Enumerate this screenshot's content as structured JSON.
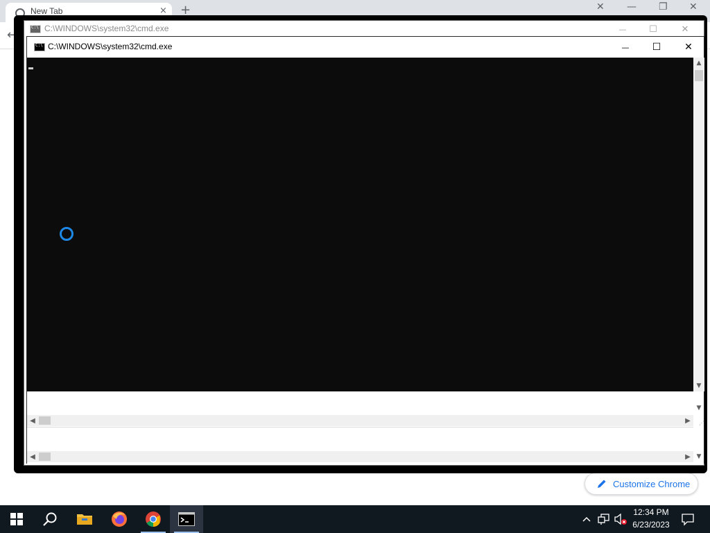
{
  "browser": {
    "tab_title": "New Tab",
    "tab_close_glyph": "×",
    "new_tab_glyph": "+",
    "back_glyph": "←",
    "customize_label": "Customize Chrome",
    "customize_icon": "pencil-icon",
    "accent_color": "#1a73e8"
  },
  "back_window": {
    "title": "C:\\WINDOWS\\system32\\cmd.exe",
    "minimize_glyph": "—",
    "maximize_glyph": "☐",
    "close_glyph": "✕"
  },
  "front_window": {
    "title": "C:\\WINDOWS\\system32\\cmd.exe",
    "minimize_glyph": "—",
    "maximize_glyph": "☐",
    "close_glyph": "✕",
    "console_background": "#0c0c0c",
    "console_text": ""
  },
  "taskbar": {
    "apps": [
      {
        "name": "start",
        "icon": "windows-logo-icon"
      },
      {
        "name": "search",
        "icon": "search-icon"
      },
      {
        "name": "file-explorer",
        "icon": "folder-icon"
      },
      {
        "name": "firefox",
        "icon": "firefox-icon"
      },
      {
        "name": "chrome",
        "icon": "chrome-icon"
      },
      {
        "name": "command-prompt",
        "icon": "cmd-icon",
        "active": true
      }
    ],
    "clock_time": "12:34 PM",
    "clock_date": "6/23/2023",
    "tray_icons": [
      "chevron-up-icon",
      "network-icon",
      "volume-muted-icon",
      "notification-icon"
    ]
  }
}
